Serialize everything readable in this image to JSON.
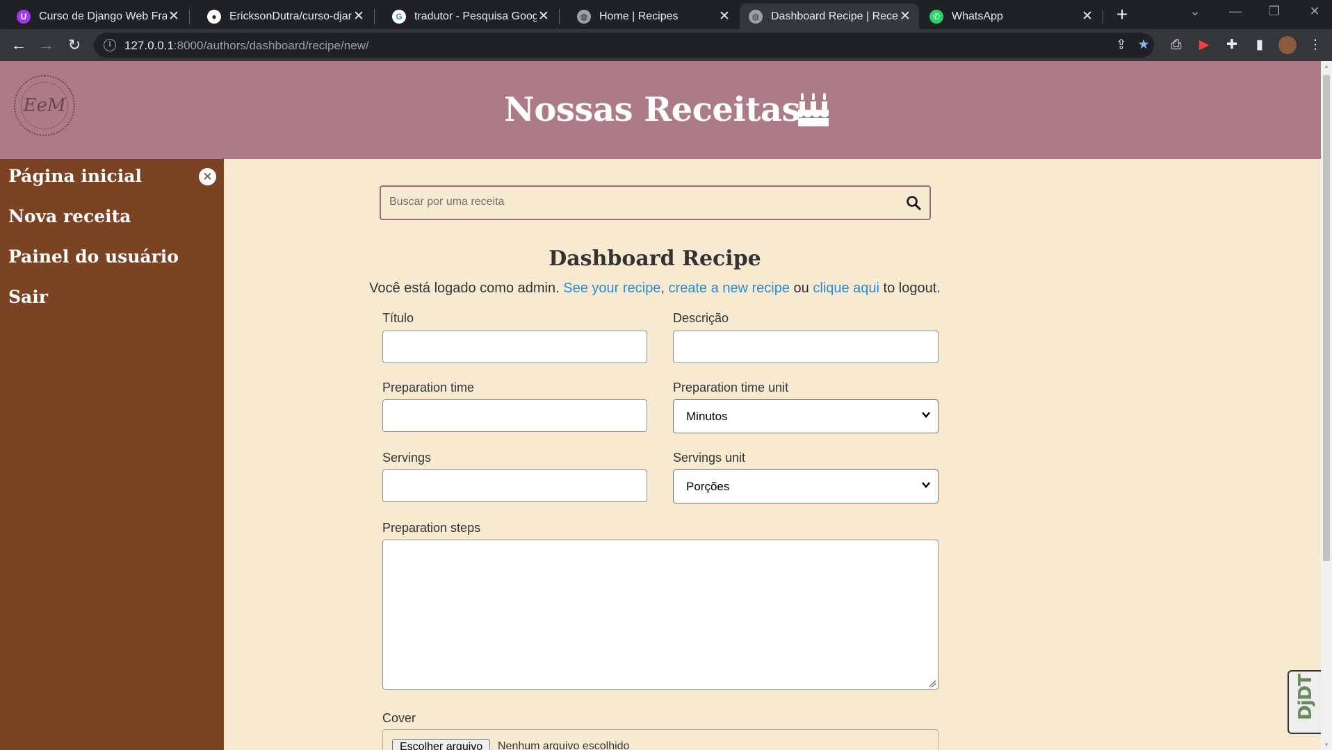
{
  "browser": {
    "tabs": [
      {
        "title": "Curso de Django Web Fram",
        "icon": "udemy-icon",
        "color": "#a435f0",
        "active": false
      },
      {
        "title": "EricksonDutra/curso-django",
        "icon": "github-icon",
        "color": "#ffffff",
        "active": false
      },
      {
        "title": "tradutor - Pesquisa Google",
        "icon": "google-icon",
        "color": "#ffffff",
        "active": false
      },
      {
        "title": "Home | Recipes",
        "icon": "globe-icon",
        "color": "#9aa0a6",
        "active": false
      },
      {
        "title": "Dashboard Recipe | Receita",
        "icon": "globe-icon",
        "color": "#9aa0a6",
        "active": true
      },
      {
        "title": "WhatsApp",
        "icon": "whatsapp-icon",
        "color": "#25d366",
        "active": false
      }
    ],
    "url_host": "127.0.0.1",
    "url_rest": ":8000/authors/dashboard/recipe/new/"
  },
  "header": {
    "logo_text": "EeM",
    "title": "Nossas Receitas"
  },
  "sidebar": {
    "items": [
      "Página inicial",
      "Nova receita",
      "Painel do usuário",
      "Sair"
    ],
    "close_symbol": "✕"
  },
  "search": {
    "placeholder": "Buscar por uma receita"
  },
  "dashboard": {
    "title": "Dashboard Recipe",
    "logged_prefix": "Você está logado como admin. ",
    "link_see": "See your recipe",
    "sep1": ", ",
    "link_create": "create a new recipe",
    "sep2": " ou ",
    "link_logout": "clique aqui",
    "suffix": " to logout."
  },
  "form": {
    "title_label": "Título",
    "description_label": "Descrição",
    "prep_time_label": "Preparation time",
    "prep_unit_label": "Preparation time unit",
    "prep_unit_value": "Minutos",
    "servings_label": "Servings",
    "servings_unit_label": "Servings unit",
    "servings_unit_value": "Porções",
    "steps_label": "Preparation steps",
    "cover_label": "Cover",
    "file_button": "Escolher arquivo",
    "file_none": "Nenhum arquivo escolhido"
  },
  "djdt": {
    "label": "DjDT"
  }
}
